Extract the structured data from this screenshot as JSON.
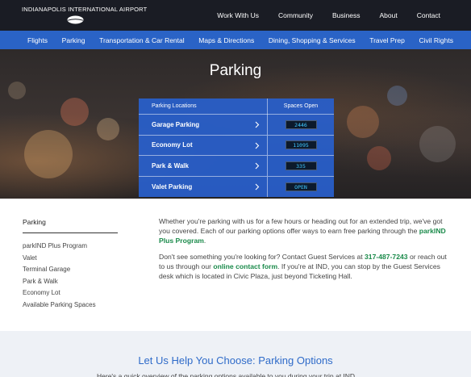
{
  "brand": {
    "name": "INDIANAPOLIS INTERNATIONAL AIRPORT",
    "logo_icon": "swoosh-icon"
  },
  "utility_nav": [
    "Work With Us",
    "Community",
    "Business",
    "About",
    "Contact"
  ],
  "main_nav": [
    "Flights",
    "Parking",
    "Transportation & Car Rental",
    "Maps & Directions",
    "Dining, Shopping & Services",
    "Travel Prep",
    "Civil Rights"
  ],
  "hero": {
    "title": "Parking"
  },
  "parking_table": {
    "headers": {
      "location": "Parking Locations",
      "spaces": "Spaces Open"
    },
    "rows": [
      {
        "name": "Garage Parking",
        "spaces": "2446"
      },
      {
        "name": "Economy Lot",
        "spaces": "11095"
      },
      {
        "name": "Park & Walk",
        "spaces": "335"
      },
      {
        "name": "Valet Parking",
        "spaces": "OPEN"
      }
    ]
  },
  "sidebar": {
    "heading": "Parking",
    "items": [
      "parkIND Plus Program",
      "Valet",
      "Terminal Garage",
      "Park & Walk",
      "Economy Lot",
      "Available Parking Spaces"
    ]
  },
  "content": {
    "p1_text": "Whether you're parking with us for a few hours or heading out for an extended trip, we've got you covered. Each of our parking options offer ways to earn free parking through the ",
    "p1_link": "parkIND Plus Program",
    "p1_end": ".",
    "p2_text": "Don't see something you're looking for? Contact Guest Services at ",
    "p2_phone": "317-487-7243",
    "p2_mid": " or reach out to us through our ",
    "p2_link": "online contact form",
    "p2_end": ". If you're at IND, you can stop by the Guest Services desk which is located in Civic Plaza, just beyond Ticketing Hall."
  },
  "bottom": {
    "heading": "Let Us Help You Choose: Parking Options",
    "cut_text": "Here's a quick overview of the parking options available to you during your trip at IND."
  },
  "colors": {
    "topbar": "#1a1c24",
    "nav": "#2a63c6",
    "link_green": "#1a8a4a",
    "heading_blue": "#2f6bc9",
    "counter_text": "#3fc9ff"
  }
}
